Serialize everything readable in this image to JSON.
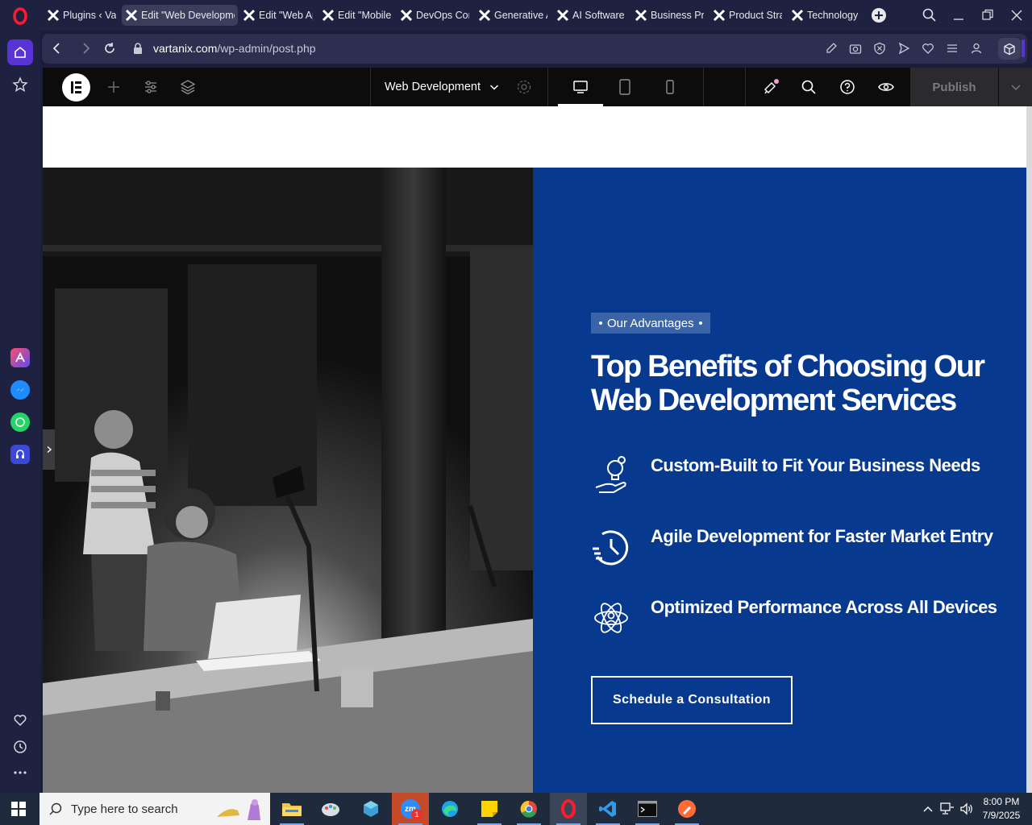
{
  "browser": {
    "tabs": [
      {
        "label": "Plugins ‹ Vart",
        "active": false
      },
      {
        "label": "Edit \"Web Developme",
        "active": true
      },
      {
        "label": "Edit \"Web Ap",
        "active": false
      },
      {
        "label": "Edit \"Mobile",
        "active": false
      },
      {
        "label": "DevOps Con",
        "active": false
      },
      {
        "label": "Generative A",
        "active": false
      },
      {
        "label": "AI Software",
        "active": false
      },
      {
        "label": "Business Pro",
        "active": false
      },
      {
        "label": "Product Strat",
        "active": false
      },
      {
        "label": "Technology S",
        "active": false
      }
    ],
    "url_domain": "vartanix.com",
    "url_path": "/wp-admin/post.php"
  },
  "elementor": {
    "document_name": "Web Development",
    "publish_label": "Publish",
    "active_device": "desktop"
  },
  "page": {
    "badge": "Our Advantages",
    "headline": "Top Benefits of Choosing Our Web Development Services",
    "features": [
      {
        "icon": "idea-hand-icon",
        "text": "Custom-Built to Fit Your Business Needs"
      },
      {
        "icon": "clock-speed-icon",
        "text": "Agile Development for Faster Market Entry"
      },
      {
        "icon": "atom-person-icon",
        "text": "Optimized Performance Across All Devices"
      }
    ],
    "cta_label": "Schedule a Consultation",
    "panel_color": "#073a8e"
  },
  "taskbar": {
    "search_placeholder": "Type here to search",
    "time": "8:00 PM",
    "date": "7/9/2025",
    "zoom_badge": "1"
  }
}
